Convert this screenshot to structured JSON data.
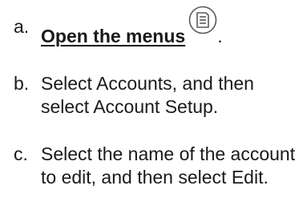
{
  "steps": [
    {
      "marker": "a.",
      "link_text": "Open the menus",
      "icon": "menu-icon",
      "trailing": "."
    },
    {
      "marker": "b.",
      "text": "Select Accounts, and then select Account Setup."
    },
    {
      "marker": "c.",
      "text": "Select the name of the account to edit, and then select Edit."
    }
  ]
}
